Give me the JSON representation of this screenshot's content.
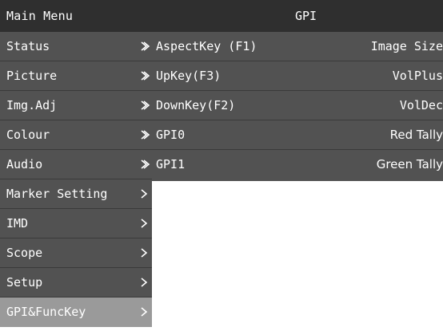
{
  "header": {
    "title": "Main Menu",
    "section": "GPI"
  },
  "menu": {
    "items": [
      {
        "label": "Status",
        "icon": "chevron-right-icon"
      },
      {
        "label": "Picture",
        "icon": "chevron-right-icon"
      },
      {
        "label": "Img.Adj",
        "icon": "chevron-right-icon"
      },
      {
        "label": "Colour",
        "icon": "chevron-right-icon"
      },
      {
        "label": "Audio",
        "icon": "chevron-right-icon"
      },
      {
        "label": "Marker Setting",
        "icon": "chevron-right-icon"
      },
      {
        "label": "IMD",
        "icon": "chevron-right-icon"
      },
      {
        "label": "Scope",
        "icon": "chevron-right-icon"
      },
      {
        "label": "Setup",
        "icon": "chevron-right-icon"
      },
      {
        "label": "GPI&FuncKey",
        "icon": "chevron-right-icon",
        "selected": true
      }
    ]
  },
  "panel": {
    "rows": [
      {
        "label": "AspectKey (F1)",
        "value": "Image Size"
      },
      {
        "label": "UpKey(F3)",
        "value": "VolPlus"
      },
      {
        "label": "DownKey(F2)",
        "value": "VolDec"
      },
      {
        "label": "GPI0",
        "value": "Red Tally"
      },
      {
        "label": "GPI1",
        "value": "Green Tally"
      }
    ]
  },
  "colors": {
    "header_bg": "#2f2f2f",
    "menu_bg": "#525252",
    "selected_bg": "#9a9a9a",
    "text": "#ffffff"
  }
}
